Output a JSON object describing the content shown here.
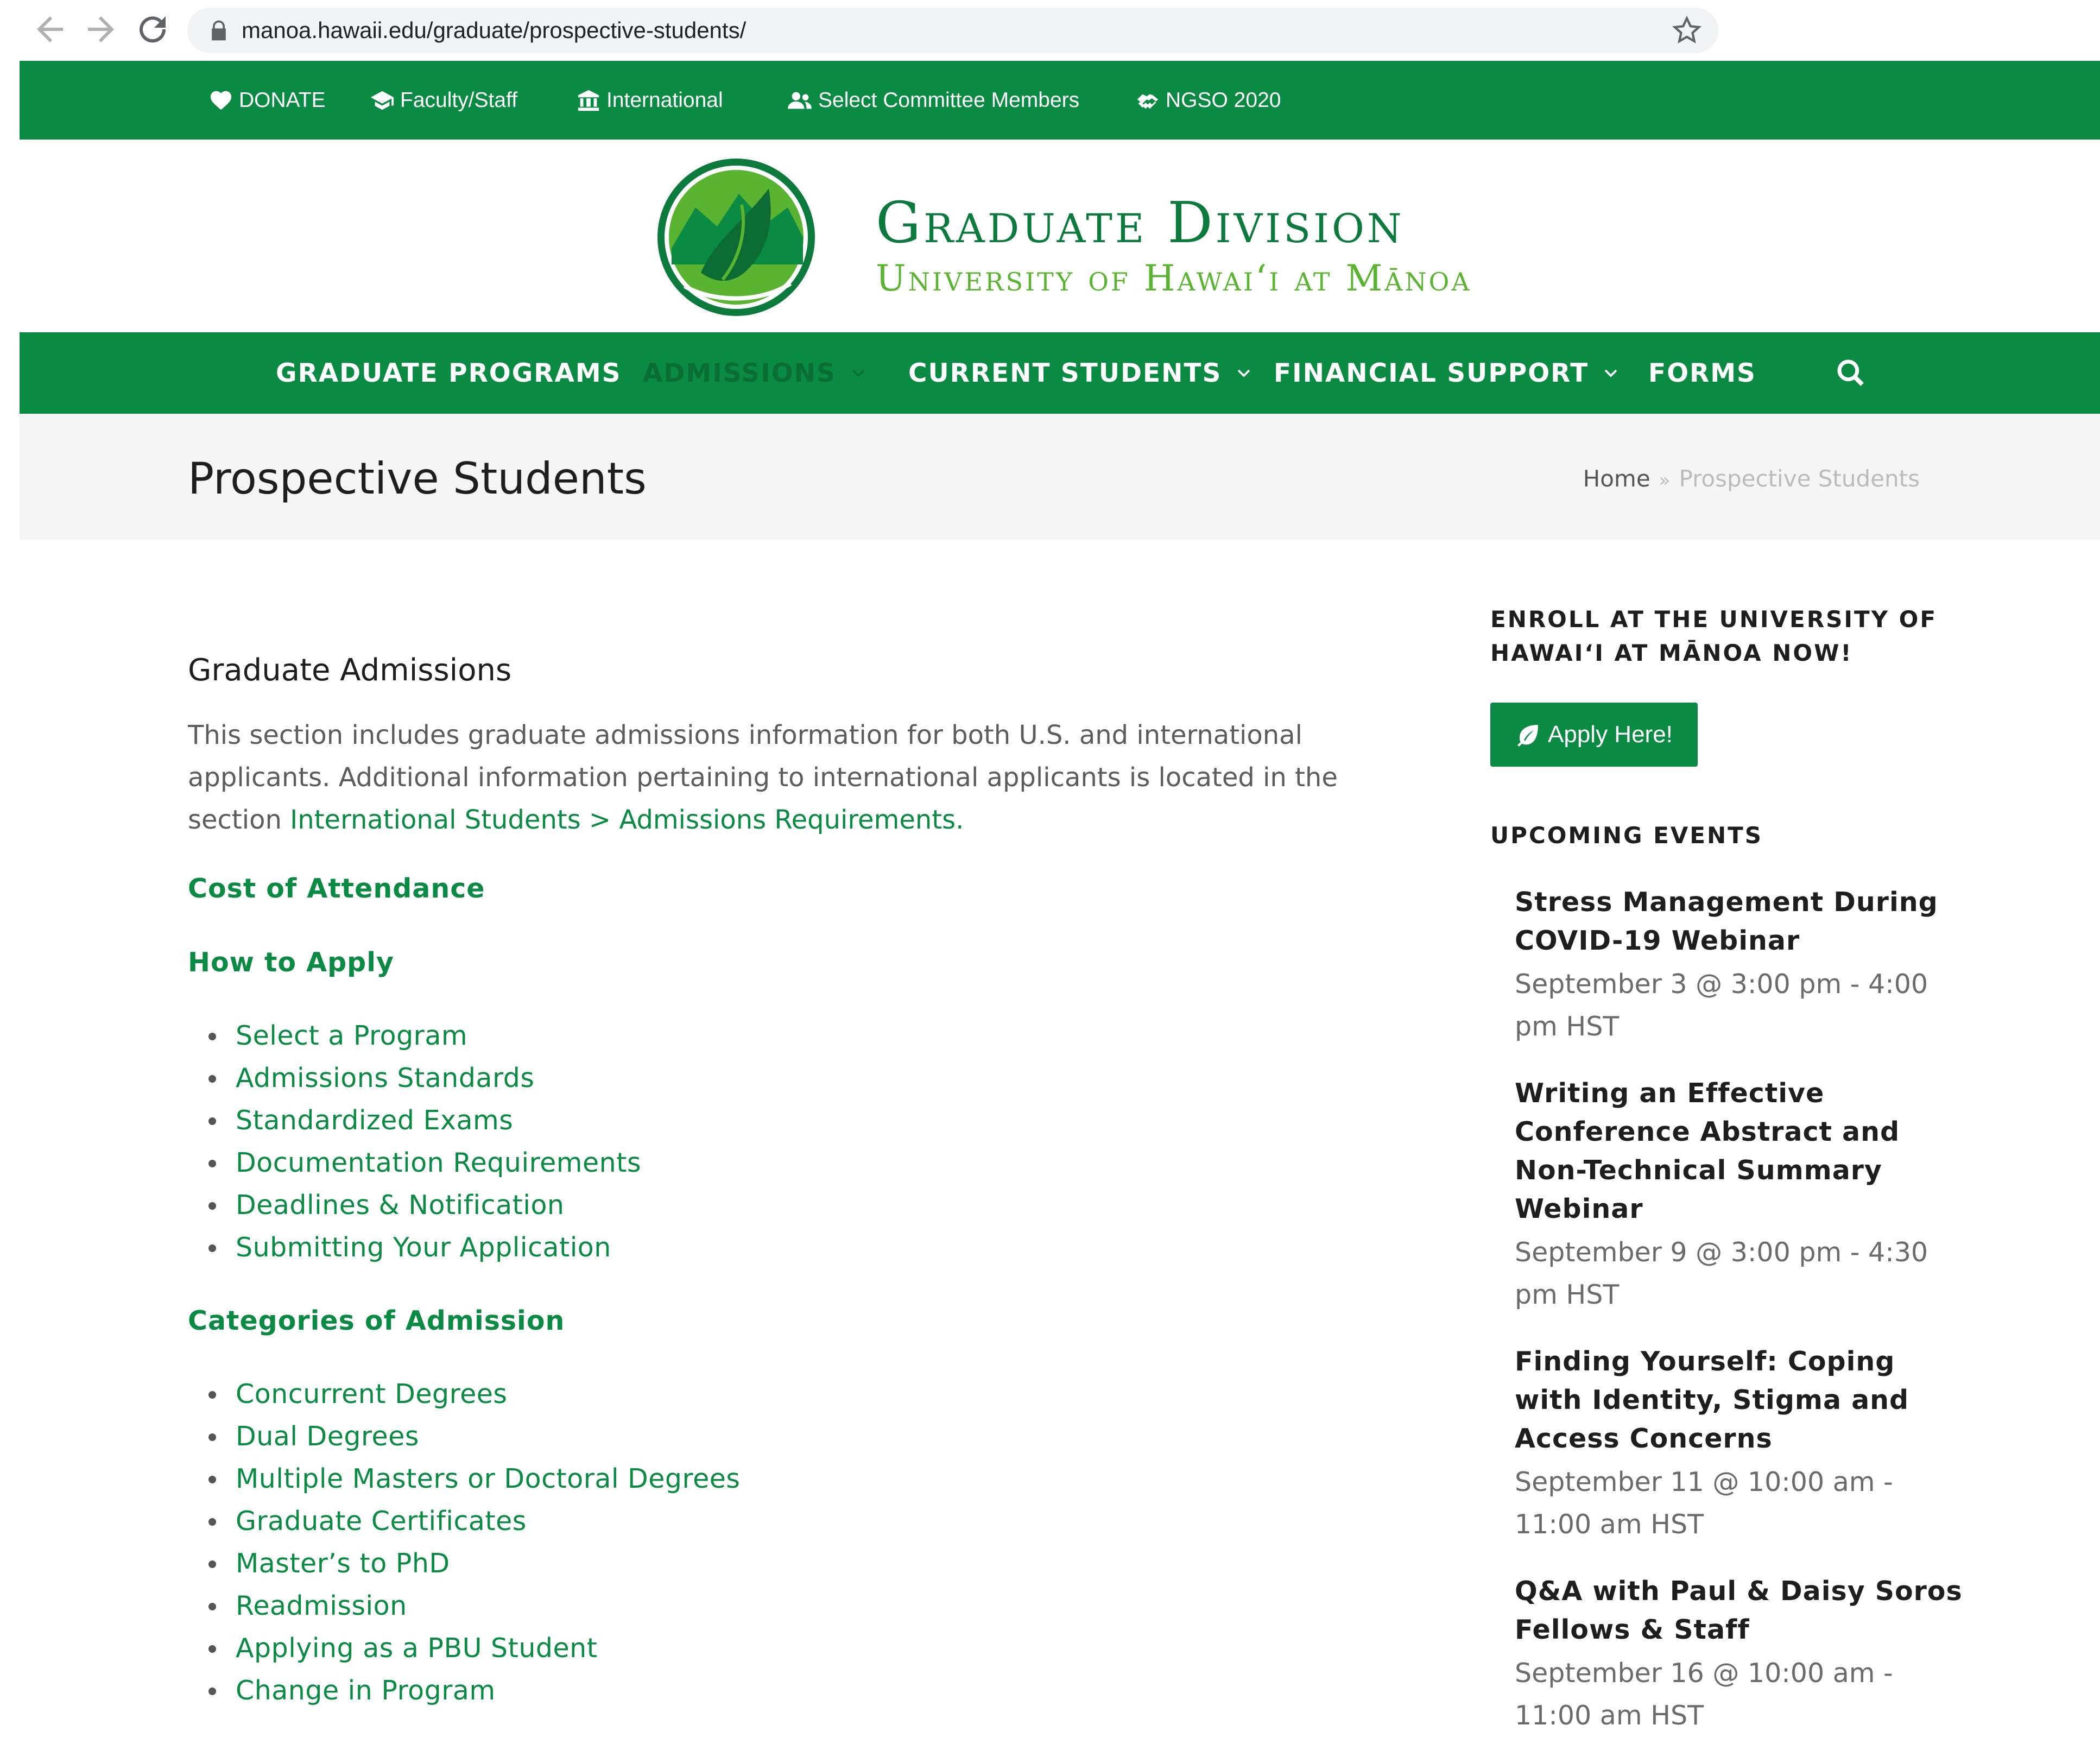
{
  "browser": {
    "url": "manoa.hawaii.edu/graduate/prospective-students/",
    "icons": [
      "back-icon",
      "forward-icon",
      "reload-icon",
      "lock-icon",
      "star-icon"
    ]
  },
  "topbar": {
    "items": [
      {
        "label": "DONATE",
        "icon": "heart-icon"
      },
      {
        "label": "Faculty/Staff",
        "icon": "graduation-cap-icon"
      },
      {
        "label": "International",
        "icon": "institution-icon"
      },
      {
        "label": "Select Committee Members",
        "icon": "users-icon"
      },
      {
        "label": "NGSO 2020",
        "icon": "handshake-icon"
      }
    ]
  },
  "logo": {
    "title": "Graduate Division",
    "subtitle": "University of Hawai‘i at Mānoa"
  },
  "mainnav": {
    "items": [
      {
        "label": "GRADUATE PROGRAMS",
        "dropdown": false
      },
      {
        "label": "ADMISSIONS",
        "dropdown": true,
        "active": true
      },
      {
        "label": "CURRENT STUDENTS",
        "dropdown": true
      },
      {
        "label": "FINANCIAL SUPPORT",
        "dropdown": true
      },
      {
        "label": "FORMS",
        "dropdown": false
      }
    ],
    "search_icon": "search-icon"
  },
  "page": {
    "title": "Prospective Students",
    "breadcrumb": {
      "home": "Home",
      "separator": "»",
      "current": "Prospective Students"
    }
  },
  "content": {
    "heading": "Graduate Admissions",
    "intro_text": "This section includes graduate admissions information for both U.S. and international applicants. Additional information pertaining to international applicants is located in the section ",
    "intro_link": "International Students > Admissions Requirements.",
    "cost_link": "Cost of Attendance",
    "how_to_apply": "How to Apply",
    "apply_links": [
      "Select a Program",
      "Admissions Standards",
      "Standardized Exams",
      "Documentation Requirements",
      "Deadlines & Notification",
      "Submitting Your Application"
    ],
    "categories_heading": "Categories of Admission",
    "category_links": [
      "Concurrent Degrees",
      "Dual Degrees",
      "Multiple Masters or Doctoral Degrees",
      "Graduate Certificates",
      "Master’s to PhD",
      "Readmission",
      "Applying as a PBU Student",
      "Change in Program"
    ]
  },
  "sidebar": {
    "enroll_title": "ENROLL AT THE UNIVERSITY OF HAWAI‘I AT MĀNOA NOW!",
    "apply_button": "Apply Here!",
    "apply_icon": "leaf-icon",
    "events_title": "UPCOMING EVENTS",
    "events": [
      {
        "title": "Stress Management During COVID-19 Webinar",
        "time": "September 3 @ 3:00 pm - 4:00 pm HST"
      },
      {
        "title": "Writing an Effective Conference Abstract and Non-Technical Summary Webinar",
        "time": "September 9 @ 3:00 pm - 4:30 pm HST"
      },
      {
        "title": "Finding Yourself: Coping with Identity, Stigma and Access Concerns",
        "time": "September 11 @ 10:00 am - 11:00 am HST"
      },
      {
        "title": "Q&A with Paul & Daisy Soros Fellows & Staff",
        "time": "September 16 @ 10:00 am - 11:00 am HST"
      }
    ]
  },
  "colors": {
    "brand_green": "#0b8a43",
    "logo_light_green": "#5bb431",
    "active_nav": "#0a6e34"
  }
}
